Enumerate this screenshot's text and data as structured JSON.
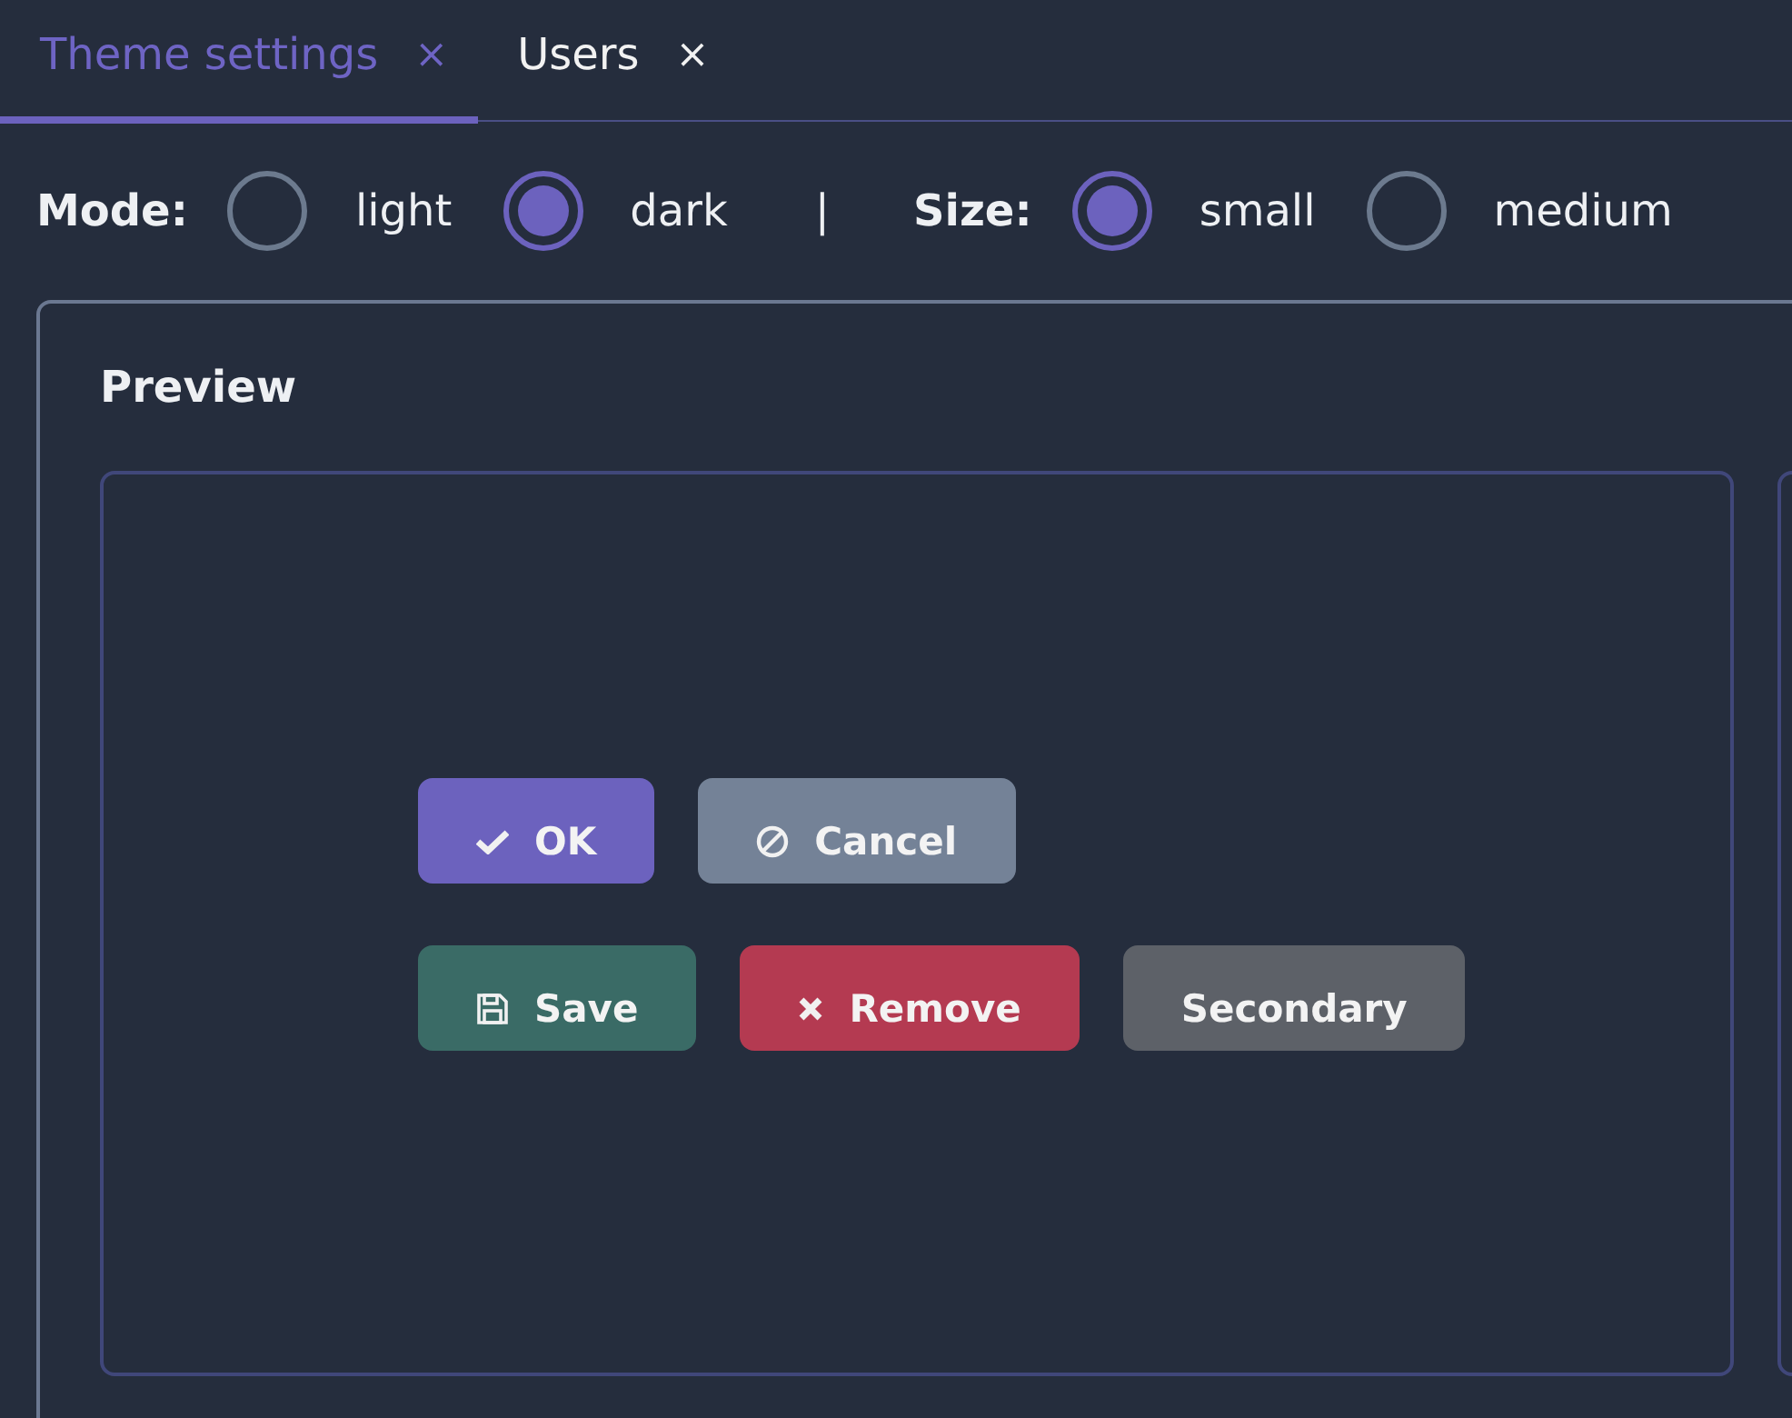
{
  "tabs": [
    {
      "label": "Theme settings",
      "close": "×",
      "selected": true
    },
    {
      "label": "Users",
      "close": "×",
      "selected": false
    }
  ],
  "options": [
    {
      "label": "Mode:",
      "choices": [
        {
          "label": "light",
          "selected": false
        },
        {
          "label": "dark",
          "selected": true
        }
      ]
    },
    {
      "label": "Size:",
      "choices": [
        {
          "label": "small",
          "selected": true
        },
        {
          "label": "medium",
          "selected": false
        }
      ]
    }
  ],
  "separator": "|",
  "preview": {
    "title": "Preview",
    "button_rows": [
      [
        {
          "label": "OK",
          "kind": "primary"
        },
        {
          "label": "Cancel",
          "kind": "cancel"
        }
      ],
      [
        {
          "label": "Save",
          "kind": "save"
        },
        {
          "label": "Remove",
          "kind": "danger"
        },
        {
          "label": "Secondary",
          "kind": "secondary"
        }
      ]
    ]
  }
}
